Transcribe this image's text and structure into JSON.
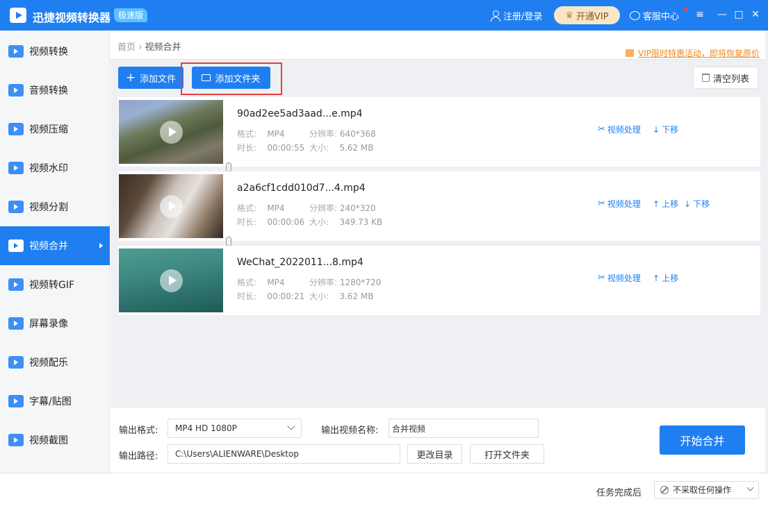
{
  "app": {
    "title": "迅捷视频转换器",
    "edition": "极速版",
    "login_label": "注册/登录",
    "vip_label": "开通VIP",
    "service_label": "客服中心",
    "menu_icon": "≡",
    "min_icon": "—",
    "max_icon": "□",
    "close_icon": "✕"
  },
  "sidebar": {
    "items": [
      {
        "label": "视频转换",
        "icon": "video-convert-icon"
      },
      {
        "label": "音频转换",
        "icon": "audio-convert-icon"
      },
      {
        "label": "视频压缩",
        "icon": "video-compress-icon"
      },
      {
        "label": "视频水印",
        "icon": "video-watermark-icon"
      },
      {
        "label": "视频分割",
        "icon": "video-split-icon"
      },
      {
        "label": "视频合并",
        "icon": "video-merge-icon",
        "active": true
      },
      {
        "label": "视频转GIF",
        "icon": "video-gif-icon"
      },
      {
        "label": "屏幕录像",
        "icon": "screen-record-icon"
      },
      {
        "label": "视频配乐",
        "icon": "video-music-icon"
      },
      {
        "label": "字幕/贴图",
        "icon": "subtitle-icon"
      },
      {
        "label": "视频截图",
        "icon": "screenshot-icon"
      }
    ]
  },
  "breadcrumb": {
    "home": "首页",
    "separator": "›",
    "current": "视频合并"
  },
  "promo": "VIP限时特惠活动，即将恢复原价",
  "toolbar": {
    "add_file": "添加文件",
    "add_folder": "添加文件夹",
    "clear_list": "清空列表"
  },
  "labels": {
    "format": "格式:",
    "resolution": "分辨率:",
    "duration": "时长:",
    "size": "大小:",
    "process": "视频处理",
    "move_up": "上移",
    "move_down": "下移"
  },
  "videos": [
    {
      "name": "90ad2ee5ad3aad...e.mp4",
      "format": "MP4",
      "resolution": "640*368",
      "duration": "00:00:55",
      "size": "5.62 MB"
    },
    {
      "name": "a2a6cf1cdd010d7...4.mp4",
      "format": "MP4",
      "resolution": "240*320",
      "duration": "00:00:06",
      "size": "349.73 KB"
    },
    {
      "name": "WeChat_2022011...8.mp4",
      "format": "MP4",
      "resolution": "1280*720",
      "duration": "00:00:21",
      "size": "3.62 MB"
    }
  ],
  "output": {
    "format_label": "输出格式:",
    "format_value": "MP4  HD 1080P",
    "name_label": "输出视频名称:",
    "name_value": "合并视频",
    "path_label": "输出路径:",
    "path_value": "C:\\Users\\ALIENWARE\\Desktop",
    "change_dir": "更改目录",
    "open_folder": "打开文件夹",
    "start": "开始合并"
  },
  "status": {
    "after_label": "任务完成后",
    "after_value": "不采取任何操作"
  },
  "colors": {
    "primary": "#1f7ff0",
    "highlight": "#e24040",
    "promo": "#f0881e"
  }
}
